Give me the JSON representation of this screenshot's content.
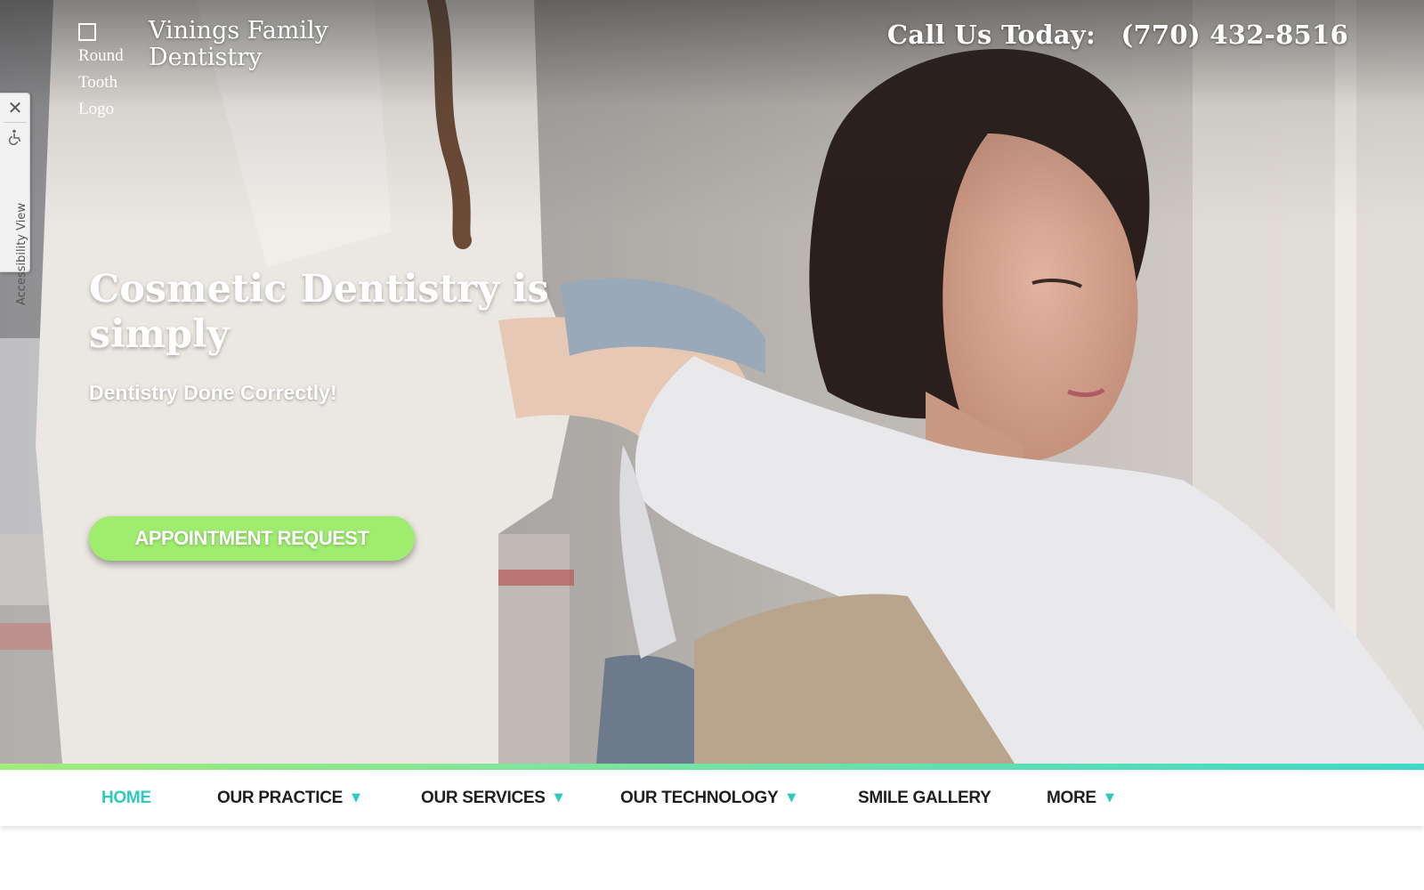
{
  "header": {
    "logo_alt_text": [
      "Round",
      "Tooth",
      "Logo"
    ],
    "brand_name": "Vinings Family Dentistry",
    "call_label": "Call Us Today:",
    "phone": "(770) 432-8516"
  },
  "accessibility": {
    "close_icon": "close-icon",
    "wheelchair_icon": "wheelchair-icon",
    "label": "Accessibility View"
  },
  "hero": {
    "headline": "Cosmetic Dentistry is simply",
    "subheadline": "Dentistry Done Correctly!",
    "cta_label": "APPOINTMENT REQUEST"
  },
  "nav": {
    "items": [
      {
        "label": "HOME",
        "active": true,
        "has_dropdown": false
      },
      {
        "label": "OUR PRACTICE",
        "active": false,
        "has_dropdown": true
      },
      {
        "label": "OUR SERVICES",
        "active": false,
        "has_dropdown": true
      },
      {
        "label": "OUR TECHNOLOGY",
        "active": false,
        "has_dropdown": true
      },
      {
        "label": "SMILE GALLERY",
        "active": false,
        "has_dropdown": false
      },
      {
        "label": "MORE",
        "active": false,
        "has_dropdown": true
      }
    ],
    "dropdown_glyph": "▼"
  },
  "colors": {
    "accent_teal": "#2fc9bd",
    "cta_green": "#9fec6f",
    "nav_text": "#1f1f1f"
  }
}
